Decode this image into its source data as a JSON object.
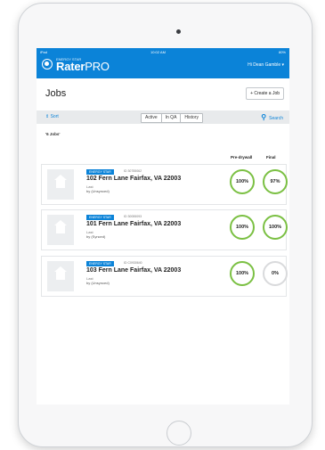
{
  "status": {
    "left": "iPad",
    "time": "10:02 AM",
    "right": "80%"
  },
  "app": {
    "logo_sub": "ENERGY STAR",
    "logo_main": "Rater",
    "logo_main_light": "PRO",
    "user_menu": "Hi Dean Gamble ▾"
  },
  "page": {
    "title": "Jobs",
    "create_button": "+ Create a Job"
  },
  "filters": {
    "sort_label": "Sort",
    "tabs": [
      "Active",
      "In QA",
      "History"
    ],
    "selected_tab": "Active",
    "search_label": "Search"
  },
  "list": {
    "count_label": "'6 Jobs'",
    "columns": {
      "pre": "Pre-drywall",
      "final": "Final"
    },
    "jobs": [
      {
        "badge": "ENERGY STAR",
        "id": "ID 30755062",
        "address": "102 Fern Lane Fairfax, VA 22003",
        "last": "Last",
        "by": "by (Unsynced)",
        "pre": "100%",
        "final": "97%"
      },
      {
        "badge": "ENERGY STAR",
        "id": "ID 30055093",
        "address": "101 Fern Lane Fairfax, VA 22003",
        "last": "Last",
        "by": "by (Synced)",
        "pre": "100%",
        "final": "100%"
      },
      {
        "badge": "ENERGY STAR",
        "id": "ID C0930640",
        "address": "103 Fern Lane Fairfax, VA 22003",
        "last": "Last",
        "by": "by (Unsynced)",
        "pre": "100%",
        "final": "0%"
      }
    ]
  },
  "colors": {
    "accent": "#0b83d8",
    "progress_green": "#7bc043",
    "progress_empty": "#d9dadc"
  }
}
